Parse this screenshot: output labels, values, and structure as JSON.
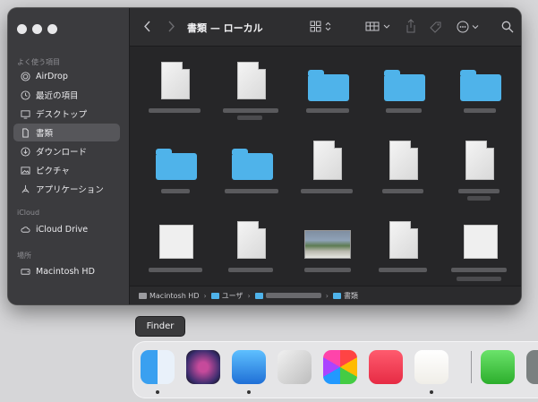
{
  "window": {
    "title": "書類 — ローカル"
  },
  "sidebar": {
    "sections": [
      {
        "heading": "よく使う項目",
        "items": [
          {
            "label": "AirDrop",
            "icon": "airdrop-icon"
          },
          {
            "label": "最近の項目",
            "icon": "clock-icon"
          },
          {
            "label": "デスクトップ",
            "icon": "desktop-icon"
          },
          {
            "label": "書類",
            "icon": "document-icon",
            "selected": true
          },
          {
            "label": "ダウンロード",
            "icon": "download-icon"
          },
          {
            "label": "ピクチャ",
            "icon": "photo-icon"
          },
          {
            "label": "アプリケーション",
            "icon": "applications-icon"
          }
        ]
      },
      {
        "heading": "iCloud",
        "items": [
          {
            "label": "iCloud Drive",
            "icon": "cloud-icon"
          }
        ]
      },
      {
        "heading": "場所",
        "items": [
          {
            "label": "Macintosh HD",
            "icon": "disk-icon"
          }
        ]
      }
    ]
  },
  "pathbar": {
    "segments": [
      "Macintosh HD",
      "ユーザ",
      "",
      "書類"
    ]
  },
  "tooltip": "Finder",
  "colors": {
    "folder": "#4fb3ea",
    "sidebar_bg": "#3b3b3e",
    "content_bg": "#262628"
  }
}
